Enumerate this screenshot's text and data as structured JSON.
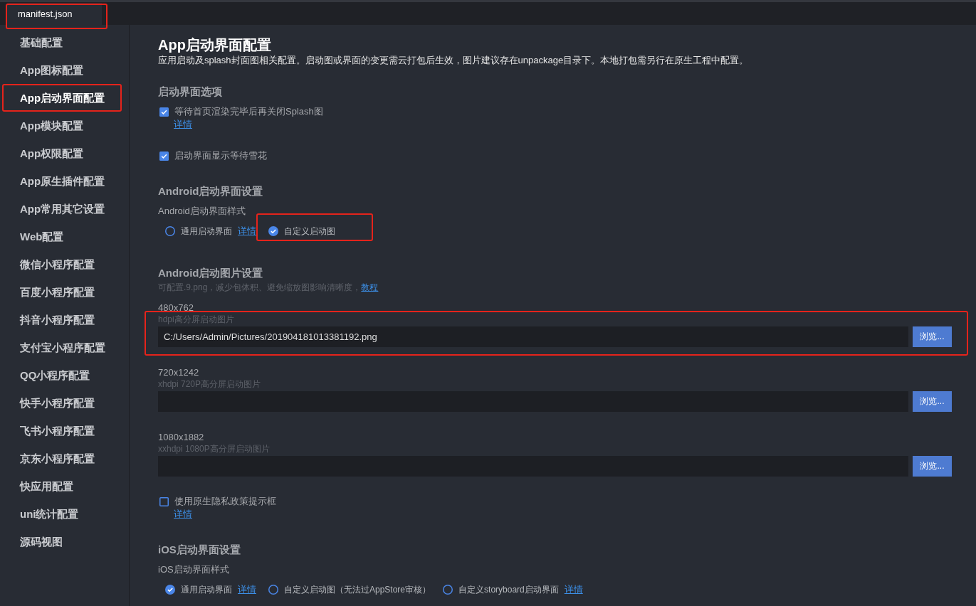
{
  "tabs": [
    {
      "label": "manifest.json",
      "selected": true,
      "highlighted": true
    }
  ],
  "sidebar": {
    "items": [
      {
        "label": "基础配置",
        "selected": false,
        "highlighted": false
      },
      {
        "label": "App图标配置",
        "selected": false,
        "highlighted": false
      },
      {
        "label": "App启动界面配置",
        "selected": true,
        "highlighted": true
      },
      {
        "label": "App模块配置",
        "selected": false,
        "highlighted": false
      },
      {
        "label": "App权限配置",
        "selected": false,
        "highlighted": false
      },
      {
        "label": "App原生插件配置",
        "selected": false,
        "highlighted": false
      },
      {
        "label": "App常用其它设置",
        "selected": false,
        "highlighted": false
      },
      {
        "label": "Web配置",
        "selected": false,
        "highlighted": false
      },
      {
        "label": "微信小程序配置",
        "selected": false,
        "highlighted": false
      },
      {
        "label": "百度小程序配置",
        "selected": false,
        "highlighted": false
      },
      {
        "label": "抖音小程序配置",
        "selected": false,
        "highlighted": false
      },
      {
        "label": "支付宝小程序配置",
        "selected": false,
        "highlighted": false
      },
      {
        "label": "QQ小程序配置",
        "selected": false,
        "highlighted": false
      },
      {
        "label": "快手小程序配置",
        "selected": false,
        "highlighted": false
      },
      {
        "label": "飞书小程序配置",
        "selected": false,
        "highlighted": false
      },
      {
        "label": "京东小程序配置",
        "selected": false,
        "highlighted": false
      },
      {
        "label": "快应用配置",
        "selected": false,
        "highlighted": false
      },
      {
        "label": "uni统计配置",
        "selected": false,
        "highlighted": false
      },
      {
        "label": "源码视图",
        "selected": false,
        "highlighted": false
      }
    ]
  },
  "page": {
    "title": "App启动界面配置",
    "description": "应用启动及splash封面图相关配置。启动图或界面的变更需云打包后生效，图片建议存在unpackage目录下。本地打包需另行在原生工程中配置。"
  },
  "sections": [
    {
      "heading": "启动界面选项",
      "rows": [
        {
          "kind": "checkbox",
          "label": "等待首页渲染完毕后再关闭Splash图",
          "checked": true,
          "link": "详情"
        },
        {
          "kind": "checkbox",
          "label": "启动界面显示等待雪花",
          "checked": true
        }
      ]
    },
    {
      "heading": "Android启动界面设置",
      "rows": [
        {
          "kind": "radio_group",
          "label": "Android启动界面样式",
          "options": [
            {
              "label": "通用启动界面",
              "selected": false,
              "link": "详情",
              "highlighted": false
            },
            {
              "label": "自定义启动图",
              "selected": true,
              "highlighted": true
            }
          ]
        }
      ]
    },
    {
      "heading": "Android启动图片设置",
      "rows": [
        {
          "kind": "note",
          "text": "可配置.9.png，减少包体积、避免缩放图影响清晰度，",
          "link": "教程"
        },
        {
          "kind": "file",
          "size": "480x762",
          "hint": "hdpi高分屏启动图片",
          "value": "C:/Users/Admin/Pictures/201904181013381192.png",
          "button": "浏览...",
          "highlighted": true
        },
        {
          "kind": "file",
          "size": "720x1242",
          "hint": "xhdpi 720P高分屏启动图片",
          "button": "浏览...",
          "highlighted": false
        },
        {
          "kind": "file",
          "size": "1080x1882",
          "hint": "xxhdpi 1080P高分屏启动图片",
          "button": "浏览...",
          "highlighted": false
        },
        {
          "kind": "checkbox",
          "label": "使用原生隐私政策提示框",
          "checked": false,
          "link": "详情"
        }
      ]
    },
    {
      "heading": "iOS启动界面设置",
      "rows": [
        {
          "kind": "radio_group",
          "label": "iOS启动界面样式",
          "options": [
            {
              "label": "通用启动界面",
              "selected": true,
              "link": "详情",
              "highlighted": false
            },
            {
              "label": "自定义启动图（无法过AppStore审核）",
              "selected": false,
              "highlighted": false
            },
            {
              "label": "自定义storyboard启动界面",
              "selected": false,
              "link": "详情",
              "highlighted": false
            }
          ]
        }
      ]
    }
  ]
}
